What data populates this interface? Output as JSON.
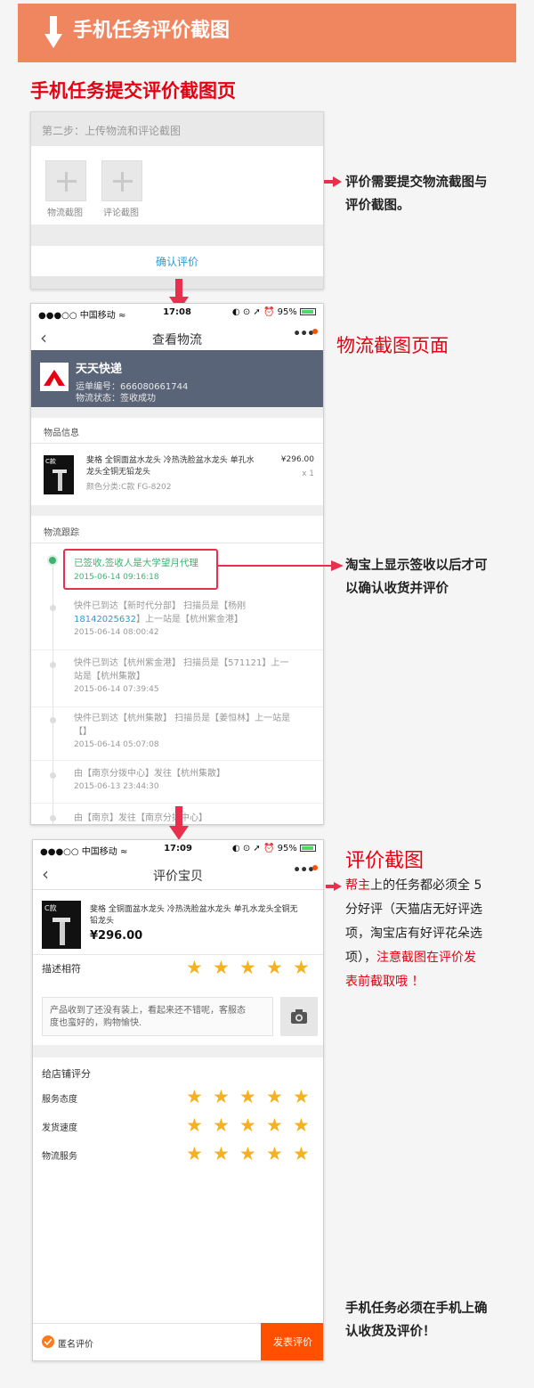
{
  "header": {
    "title": "手机任务评价截图"
  },
  "section1": {
    "title": "手机任务提交评价截图页"
  },
  "submit_page": {
    "step_label": "第二步：上传物流和评论截图",
    "upload1": "物流截图",
    "upload2": "评论截图",
    "confirm": "确认评价"
  },
  "note1": [
    "评价需要提交物流截图与",
    "评价截图。"
  ],
  "logistics_heading": "物流截图页面",
  "logistics": {
    "status_left": "●●●○○ 中国移动 ≈",
    "status_time": "17:08",
    "status_right": "95%",
    "nav_title": "查看物流",
    "courier": "天天快递",
    "tracking_no": "运单编号：666080661744",
    "status": "物流状态：签收成功",
    "item_section": "物品信息",
    "item_name_1": "斐格 全铜面盆水龙头 冷热洗脸盆水龙头 单孔水",
    "item_name_2": "龙头全铜无铅龙头",
    "item_spec": "颜色分类:C款 FG-8202",
    "item_price": "¥296.00",
    "item_qty": "x 1",
    "thumb_label": "C款",
    "track_section": "物流跟踪",
    "signed_text": "已签收,签收人是大学望月代理",
    "signed_time": "2015-06-14 09:16:18",
    "tracks": [
      {
        "line1": "快件已到达【新时代分部】 扫描员是【杨刚",
        "line2a": "18142025632",
        "line2b": "】上一站是【杭州紫金港】",
        "time": "2015-06-14 08:00:42"
      },
      {
        "line1": "快件已到达【杭州紫金港】 扫描员是【571121】上一",
        "line2": "站是【杭州集散】",
        "time": "2015-06-14 07:39:45"
      },
      {
        "line1": "快件已到达【杭州集散】 扫描员是【姜恒林】上一站是",
        "line2": "【】",
        "time": "2015-06-14 05:07:08"
      },
      {
        "line1": "由【南京分拨中心】发往【杭州集散】",
        "time": "2015-06-13 23:44:30"
      },
      {
        "line1": "由【南京】发往【南京分拨中心】"
      }
    ]
  },
  "note2": [
    "淘宝上显示签收以后才可",
    "以确认收货并评价"
  ],
  "review_heading": "评价截图",
  "review": {
    "status_left": "●●●○○ 中国移动 ≈",
    "status_time": "17:09",
    "status_right": "95%",
    "nav_title": "评价宝贝",
    "item_name_1": "斐格 全铜面盆水龙头 冷热洗脸盆水龙头 单孔水龙头全铜无",
    "item_name_2": "铅龙头",
    "item_price": "¥296.00",
    "thumb_label": "C款",
    "desc_label": "描述相符",
    "comment_1": "产品收到了还没有装上，看起来还不错呢，客服态",
    "comment_2": "度也蛮好的，购物愉快.",
    "shop_section": "给店铺评分",
    "service": "服务态度",
    "shipping": "发货速度",
    "logistics": "物流服务",
    "desc_stars": 5,
    "service_stars": 5,
    "shipping_stars": 5,
    "logistics_stars": 5,
    "anonymous": "匿名评价",
    "publish": "发表评价"
  },
  "note3": {
    "p1": "帮主",
    "p2": "上的任务都必须全 5",
    "p3": "分好评（天猫店无好评选",
    "p4": "项，淘宝店有好评花朵选",
    "p5": "项），",
    "p6": "注意截图在评价发",
    "p7": "表前截取哦 ！"
  },
  "note4": [
    "手机任务必须在手机上确",
    "认收货及评价！"
  ],
  "colors": {
    "header": "#f08660",
    "accent_red": "#e60012",
    "arrow": "#e8304e",
    "orange": "#ff5000",
    "green": "#3cb371",
    "star": "#f5b21c"
  }
}
